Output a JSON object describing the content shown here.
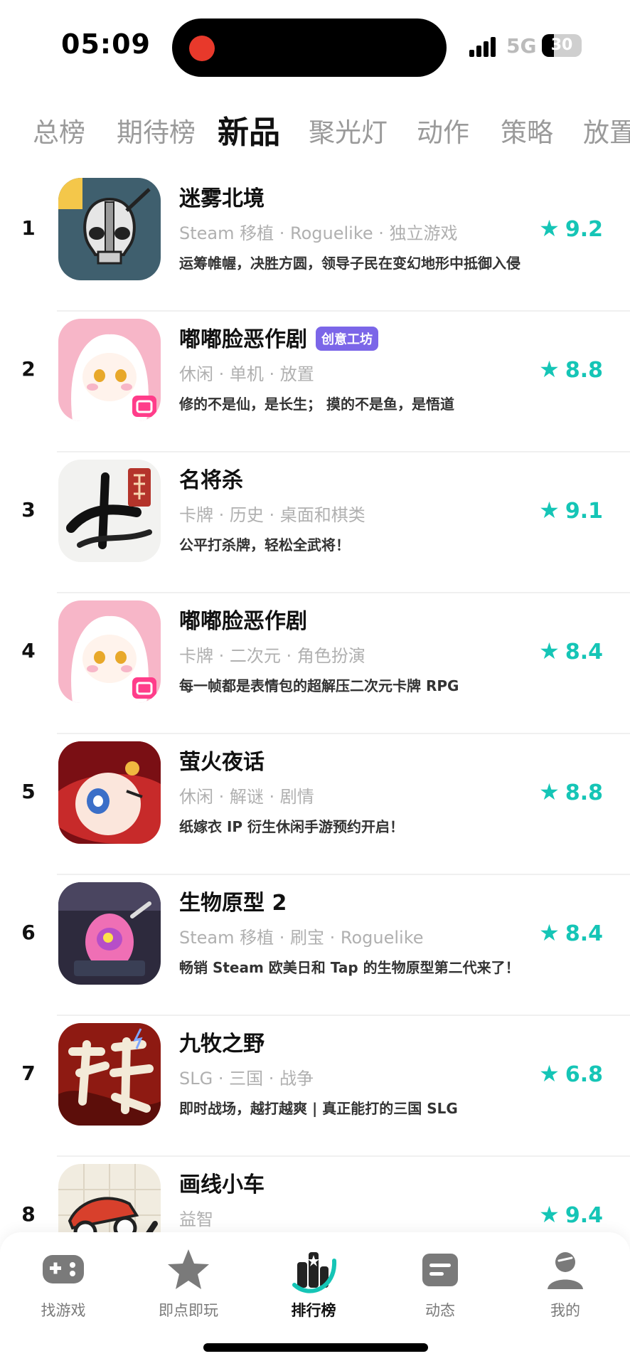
{
  "status_bar": {
    "time": "05:09",
    "network": "5G",
    "battery": "30",
    "battery_level": 0.3
  },
  "tabs": [
    {
      "label": "总榜",
      "active": false
    },
    {
      "label": "期待榜",
      "active": false
    },
    {
      "label": "新品",
      "active": true
    },
    {
      "label": "聚光灯",
      "active": false
    },
    {
      "label": "动作",
      "active": false
    },
    {
      "label": "策略",
      "active": false
    },
    {
      "label": "放置",
      "active": false
    }
  ],
  "games": [
    {
      "rank": "1",
      "name": "迷雾北境",
      "badge": "",
      "tags": "Steam 移植 · Roguelike · 独立游戏",
      "desc": "运筹帷幄，决胜方圆，领导子民在变幻地形中抵御入侵",
      "rating": "9.2",
      "icon": "skull-knight-icon"
    },
    {
      "rank": "2",
      "name": "嘟嘟脸恶作剧",
      "badge": "创意工坊",
      "tags": "休闲 · 单机 · 放置",
      "desc": "修的不是仙，是长生； 摸的不是鱼，是悟道",
      "rating": "8.8",
      "icon": "anime-girl-icon"
    },
    {
      "rank": "3",
      "name": "名将杀",
      "badge": "",
      "tags": "卡牌 · 历史 · 桌面和棋类",
      "desc": "公平打杀牌，轻松全武将！",
      "rating": "9.1",
      "icon": "calligraphy-icon"
    },
    {
      "rank": "4",
      "name": "嘟嘟脸恶作剧",
      "badge": "",
      "tags": "卡牌 · 二次元 · 角色扮演",
      "desc": "每一帧都是表情包的超解压二次元卡牌 RPG",
      "rating": "8.4",
      "icon": "anime-girl-icon"
    },
    {
      "rank": "5",
      "name": "萤火夜话",
      "badge": "",
      "tags": "休闲 · 解谜 · 剧情",
      "desc": "纸嫁衣 IP 衍生休闲手游预约开启！",
      "rating": "8.8",
      "icon": "bride-girl-icon"
    },
    {
      "rank": "6",
      "name": "生物原型 2",
      "badge": "",
      "tags": "Steam 移植 · 刷宝 · Roguelike",
      "desc": "畅销 Steam 欧美日和 Tap 的生物原型第二代来了！",
      "rating": "8.4",
      "icon": "lab-creature-icon"
    },
    {
      "rank": "7",
      "name": "九牧之野",
      "badge": "",
      "tags": "SLG · 三国 · 战争",
      "desc": "即时战场，越打越爽 | 真正能打的三国 SLG",
      "rating": "6.8",
      "icon": "red-calligraphy-icon"
    },
    {
      "rank": "8",
      "name": "画线小车",
      "badge": "",
      "tags": "益智",
      "desc": "",
      "rating": "9.4",
      "icon": "drawn-car-icon"
    }
  ],
  "bottom_nav": [
    {
      "label": "找游戏",
      "icon": "gamepad-icon",
      "active": false
    },
    {
      "label": "即点即玩",
      "icon": "star-icon",
      "active": false
    },
    {
      "label": "排行榜",
      "icon": "ranking-icon",
      "active": true
    },
    {
      "label": "动态",
      "icon": "feed-icon",
      "active": false
    },
    {
      "label": "我的",
      "icon": "profile-icon",
      "active": false
    }
  ],
  "colors": {
    "accent": "#15c5b6",
    "badge": "#7b66e8",
    "tab_inactive": "#9a9a9a"
  }
}
